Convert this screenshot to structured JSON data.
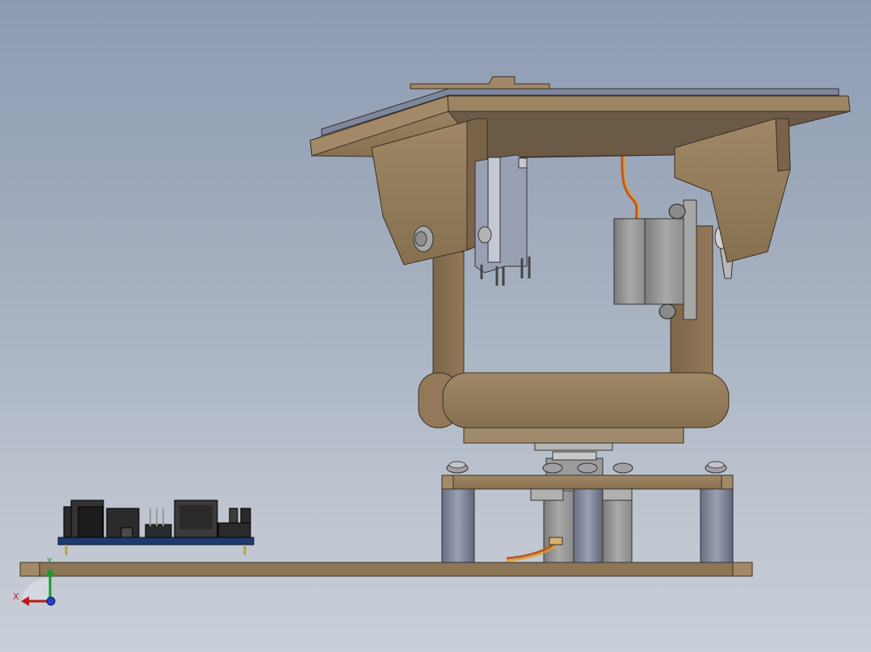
{
  "viewport": {
    "background_top": "#8d9bb2",
    "background_bottom": "#c9cfd8"
  },
  "model": {
    "wood_color": "#8b7457",
    "wood_dark": "#5f5140",
    "servo_color": "#9a9a9a",
    "frame_color": "#7a8194",
    "pcb_color": "#1f3a6e",
    "wire_color": "#c05a1c"
  },
  "triad": {
    "x_label": "X",
    "y_label": "Y",
    "x_color": "#c01818",
    "y_color": "#1a9a2a",
    "z_color": "#2040c8"
  }
}
